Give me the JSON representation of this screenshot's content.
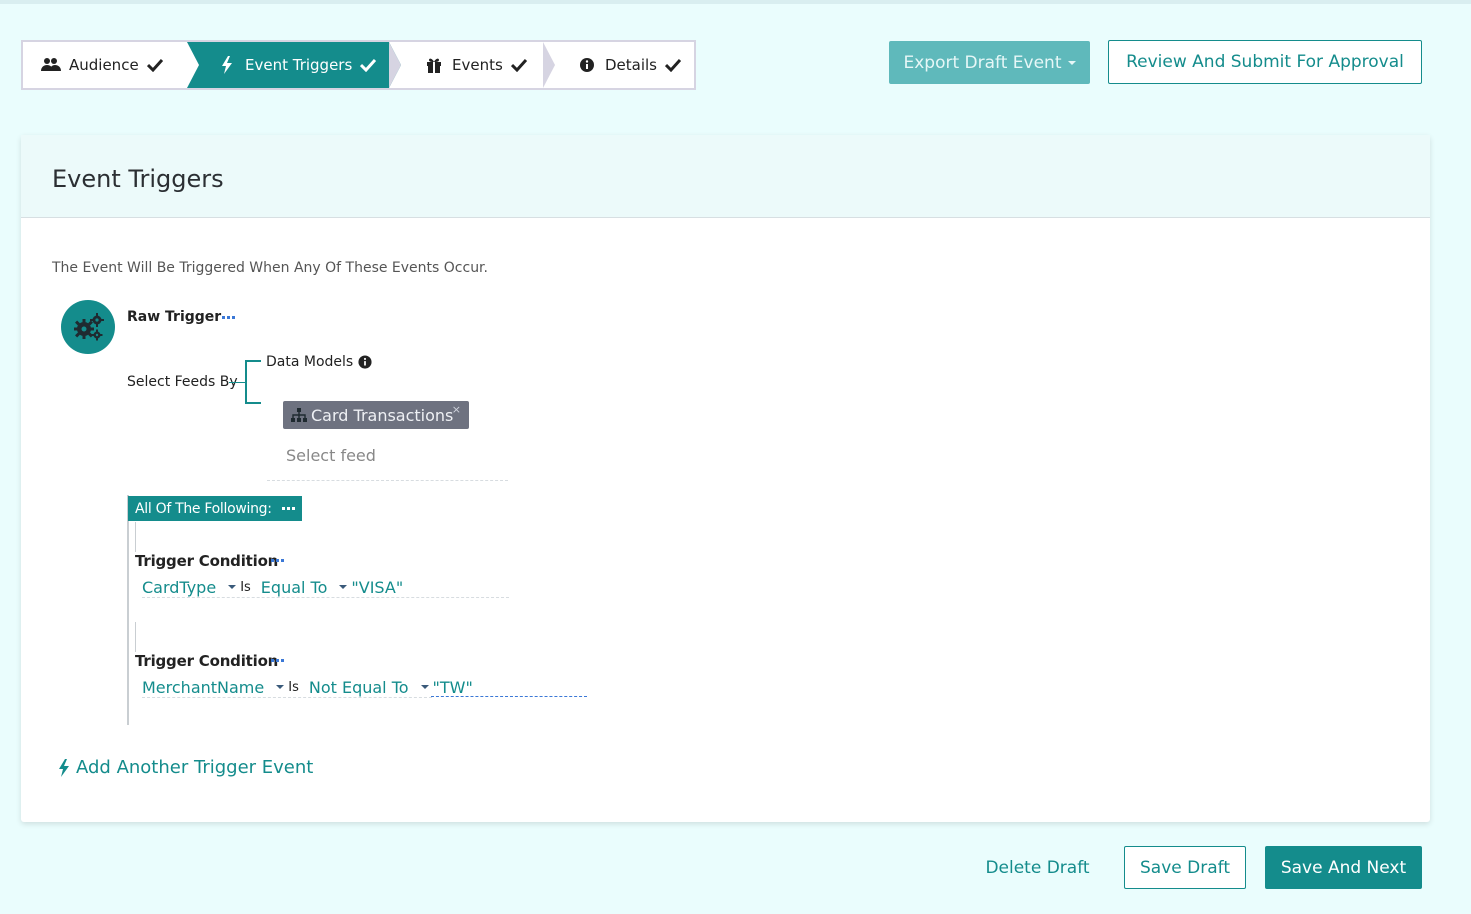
{
  "stepper": {
    "steps": [
      {
        "label": "Audience",
        "icon": "users-icon",
        "done": true,
        "active": false
      },
      {
        "label": "Event Triggers",
        "icon": "bolt-icon",
        "done": true,
        "active": true
      },
      {
        "label": "Events",
        "icon": "gift-icon",
        "done": true,
        "active": false
      },
      {
        "label": "Details",
        "icon": "info-icon",
        "done": true,
        "active": false
      }
    ]
  },
  "header_actions": {
    "export_label": "Export Draft Event",
    "review_label": "Review And Submit For Approval"
  },
  "card": {
    "title": "Event Triggers",
    "description": "The Event Will Be Triggered When Any Of These Events Occur.",
    "raw_trigger": {
      "label": "Raw Trigger",
      "select_feeds_label": "Select Feeds By",
      "data_models_label": "Data Models",
      "selected_feed": "Card Transactions",
      "feed_placeholder": "Select feed"
    },
    "group": {
      "label": "All Of The Following:",
      "conditions": [
        {
          "label": "Trigger Condition",
          "field": "CardType",
          "is": "Is",
          "operator": "Equal To",
          "value": "\"VISA\""
        },
        {
          "label": "Trigger Condition",
          "field": "MerchantName",
          "is": "Is",
          "operator": "Not Equal To",
          "value": "\"TW\""
        }
      ]
    },
    "add_trigger_label": "Add Another Trigger Event"
  },
  "footer_actions": {
    "delete_label": "Delete Draft",
    "save_label": "Save Draft",
    "next_label": "Save And Next"
  },
  "colors": {
    "accent": "#148c8c",
    "background": "#eafdfd",
    "chip": "#6e7280"
  }
}
